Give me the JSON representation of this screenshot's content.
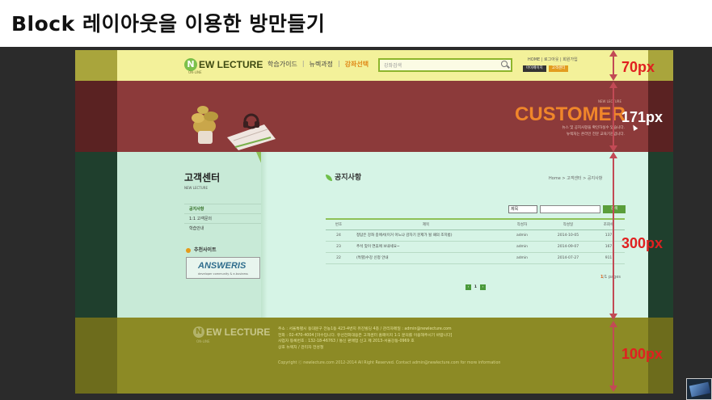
{
  "slide": {
    "title": "Block 레이아웃을 이용한 방만들기"
  },
  "header": {
    "logo_mark": "N",
    "logo_text": "EW LECTURE",
    "logo_sub": "ON-LINE",
    "nav": [
      "학습가이드",
      "뉴렉과정",
      "강좌선택"
    ],
    "search_placeholder": "강좌검색",
    "util_links": "HOME | 로그아웃 | 회원가입",
    "util_buttons": [
      "마이페이지",
      "고객센터"
    ]
  },
  "visual": {
    "sub": "NEW LECTURE",
    "title": "CUSTOMER",
    "desc_line1": "뉴스 및 공지사항을 확인하실수 있습니다.",
    "desc_line2": "뉴렉처는 온라인 전문 교육기관입니다."
  },
  "sidebar": {
    "title": "고객센터",
    "sub": "NEW LECTURE",
    "items": [
      "공지사항",
      "1:1 고객문의",
      "학습안내"
    ],
    "rec_title": "추천사이트",
    "answers_logo": "ANSWERIS",
    "answers_sub": "developer community & e-business"
  },
  "board": {
    "title": "공지사항",
    "breadcrumb": "Home > 고객센터 > 공지사항",
    "search_field": "제목",
    "search_button": "검색",
    "columns": [
      "번호",
      "제목",
      "작성자",
      "작성일",
      "조회수"
    ],
    "rows": [
      {
        "no": "24",
        "subject": "정답은 강좌 중에서(이거 아느냐 감자기 문제가 될 때의 조치법)",
        "writer": "admin",
        "date": "2014-10-05",
        "hits": "137"
      },
      {
        "no": "23",
        "subject": "추석 맞이 연휴에 보내세요~",
        "writer": "admin",
        "date": "2014-09-07",
        "hits": "167"
      },
      {
        "no": "22",
        "subject": "(특별)수강 신청 안내",
        "writer": "admin",
        "date": "2014-07-27",
        "hits": "911"
      }
    ],
    "pages_current": "1",
    "pages_total": "/1 pages",
    "pager_num": "1"
  },
  "footer": {
    "logo_mark": "N",
    "logo_text": "EW LECTURE",
    "logo_sub": "ON-LINE",
    "info": [
      "주소 : 서울특별시 동대문구 전농1동 423-4번지 유진빌딩 4층 / 관리자메일 : admin@newlecture.com",
      "전화 : 02-470-4004 [미수입니다. 유선전화대응은 고객센터 홈페이지 1:1 문의를 이용해주시기 바랍니다]",
      "사업자 등록번호 : 132-18-46763 / 통신 판매업 신고 제 2013-서울강동-0969 호",
      "상호 뉴렉처 / 관리자 전성철"
    ],
    "copyright": "Copyright ⓒ newlecture.com 2012-2014 All Right Reserved. Contact admin@newlecture.com for more information"
  },
  "annotations": [
    {
      "label": "70px",
      "color": "#e02020"
    },
    {
      "label": "171px",
      "color": "#ffffff"
    },
    {
      "label": "300px",
      "color": "#e02020"
    },
    {
      "label": "100px",
      "color": "#e02020"
    }
  ]
}
